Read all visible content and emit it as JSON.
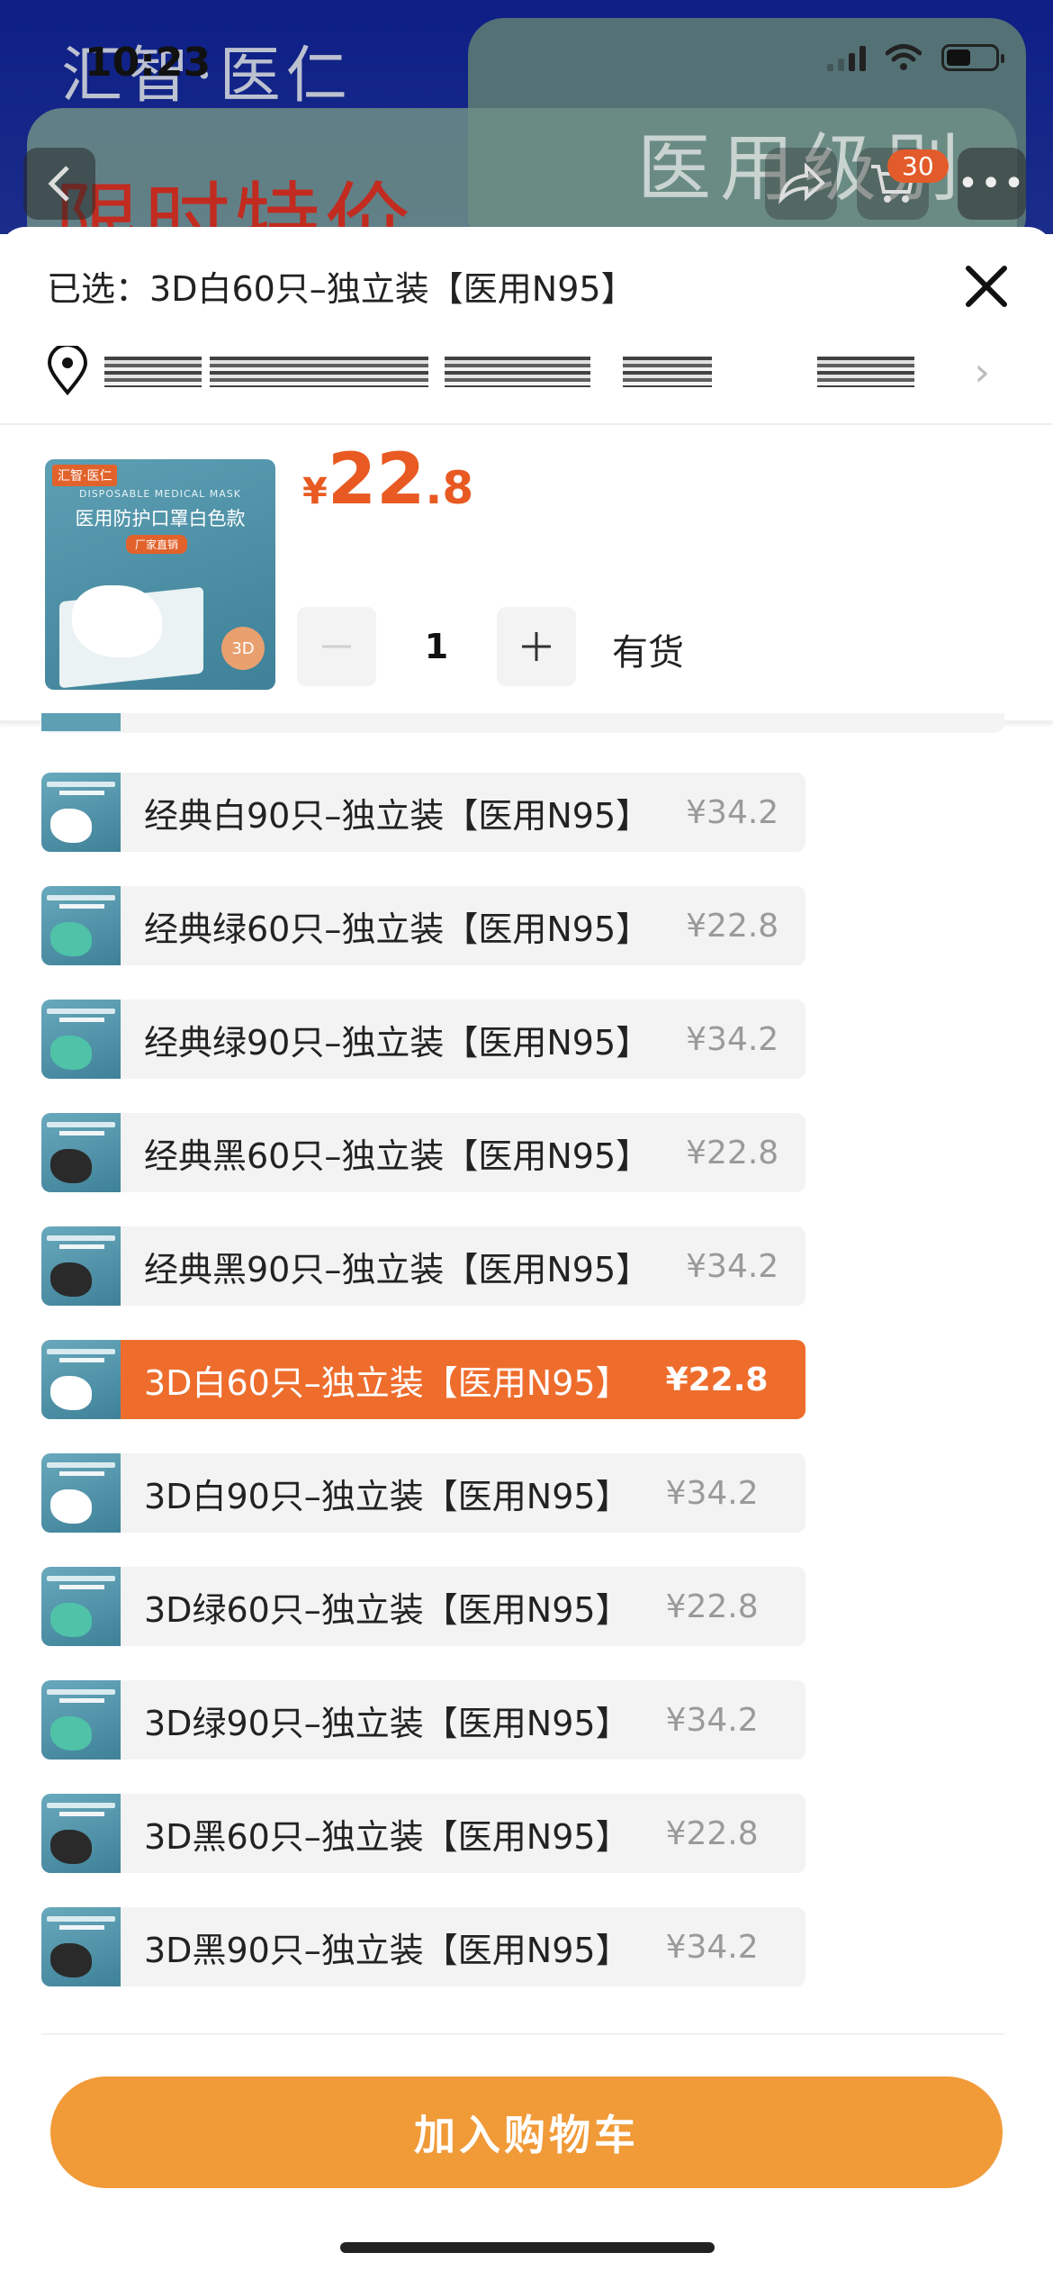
{
  "status_bar": {
    "time": "10:23"
  },
  "background": {
    "brand": "汇智·医仁",
    "promo_text": "限时特价",
    "medical_level": "医用级别",
    "cart_count": "30"
  },
  "sheet": {
    "selected_prefix": "已选：",
    "selected_value": "3D白60只–独立装【医用N95】",
    "product": {
      "thumb_tag": "汇智·医仁",
      "thumb_sub": "DISPOSABLE MEDICAL MASK",
      "thumb_title": "医用防护口罩白色款",
      "thumb_badge": "厂家直销",
      "thumb_3d": "3D",
      "price_currency": "¥",
      "price_int": "22",
      "price_dec": ".8",
      "quantity": "1",
      "stock": "有货"
    },
    "options": [
      {
        "label": "经典白90只–独立装【医用N95】",
        "price": "¥34.2",
        "mask": "white"
      },
      {
        "label": "经典绿60只–独立装【医用N95】",
        "price": "¥22.8",
        "mask": "green"
      },
      {
        "label": "经典绿90只–独立装【医用N95】",
        "price": "¥34.2",
        "mask": "green"
      },
      {
        "label": "经典黑60只–独立装【医用N95】",
        "price": "¥22.8",
        "mask": "black"
      },
      {
        "label": "经典黑90只–独立装【医用N95】",
        "price": "¥34.2",
        "mask": "black"
      },
      {
        "label": "3D白60只–独立装【医用N95】",
        "price": "¥22.8",
        "mask": "white",
        "selected": true
      },
      {
        "label": "3D白90只–独立装【医用N95】",
        "price": "¥34.2",
        "mask": "white"
      },
      {
        "label": "3D绿60只–独立装【医用N95】",
        "price": "¥22.8",
        "mask": "green"
      },
      {
        "label": "3D绿90只–独立装【医用N95】",
        "price": "¥34.2",
        "mask": "green"
      },
      {
        "label": "3D黑60只–独立装【医用N95】",
        "price": "¥22.8",
        "mask": "black"
      },
      {
        "label": "3D黑90只–独立装【医用N95】",
        "price": "¥34.2",
        "mask": "black"
      }
    ],
    "add_to_cart": "加入购物车"
  },
  "colors": {
    "accent": "#ee6d2d",
    "price": "#e85a22",
    "cart_button": "#f19a38"
  }
}
